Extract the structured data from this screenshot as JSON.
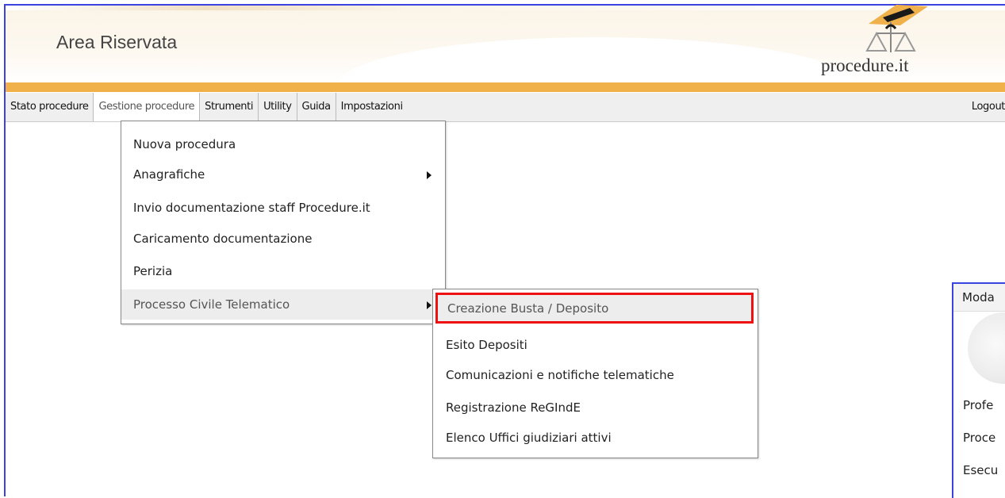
{
  "header": {
    "title": "Area Riservata",
    "logo_text": "procedure.it",
    "logo_icon": "scales-of-justice-icon"
  },
  "menubar": {
    "items": [
      {
        "label": "Stato procedure"
      },
      {
        "label": "Gestione procedure"
      },
      {
        "label": "Strumenti"
      },
      {
        "label": "Utility"
      },
      {
        "label": "Guida"
      },
      {
        "label": "Impostazioni"
      }
    ],
    "logout": "Logout"
  },
  "dropdown": {
    "items": [
      {
        "label": "Nuova procedura"
      },
      {
        "label": "Anagrafiche"
      },
      {
        "label": "Invio documentazione staff Procedure.it"
      },
      {
        "label": "Caricamento documentazione"
      },
      {
        "label": "Perizia"
      },
      {
        "label": "Processo Civile Telematico"
      }
    ]
  },
  "submenu": {
    "items": [
      {
        "label": "Creazione Busta / Deposito"
      },
      {
        "label": "Esito Depositi"
      },
      {
        "label": "Comunicazioni e notifiche telematiche"
      },
      {
        "label": "Registrazione ReGIndE"
      },
      {
        "label": "Elenco Uffici giudiziari attivi"
      }
    ]
  },
  "side_panel": {
    "header": "Moda",
    "lines": [
      "Profe",
      "Proce",
      "Esecu"
    ]
  },
  "colors": {
    "accent_orange": "#f0b04a",
    "frame_blue": "#3a43e0",
    "highlight_red": "#ee1111"
  }
}
